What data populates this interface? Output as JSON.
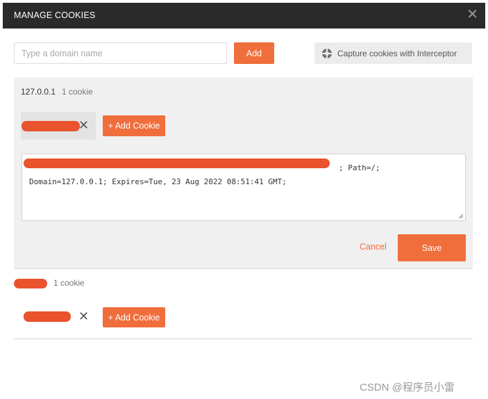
{
  "dialog": {
    "title": "MANAGE COOKIES",
    "close_icon": "close-icon"
  },
  "toolbar": {
    "domain_placeholder": "Type a domain name",
    "domain_value": "",
    "add_label": "Add",
    "interceptor_label": "Capture cookies with Interceptor",
    "interceptor_icon": "interceptor-icon"
  },
  "domains": [
    {
      "name": "127.0.0.1",
      "count": "1 cookie",
      "cookie_name_redacted": true,
      "add_cookie_label": "+ Add Cookie",
      "editor_lines": [
        "; Path=/;",
        "Domain=127.0.0.1; Expires=Tue, 23 Aug 2022 08:51:41 GMT;"
      ],
      "cancel_label": "Cancel",
      "save_label": "Save"
    },
    {
      "name_redacted": true,
      "count": "1 cookie",
      "cookie_name_redacted": true,
      "add_cookie_label": "+ Add Cookie"
    }
  ],
  "watermark": "CSDN @程序员小雷",
  "colors": {
    "accent": "#f06d3c",
    "titlebar": "#2a2a2a",
    "panel": "#f0f0f0",
    "redaction": "#e9542e"
  }
}
